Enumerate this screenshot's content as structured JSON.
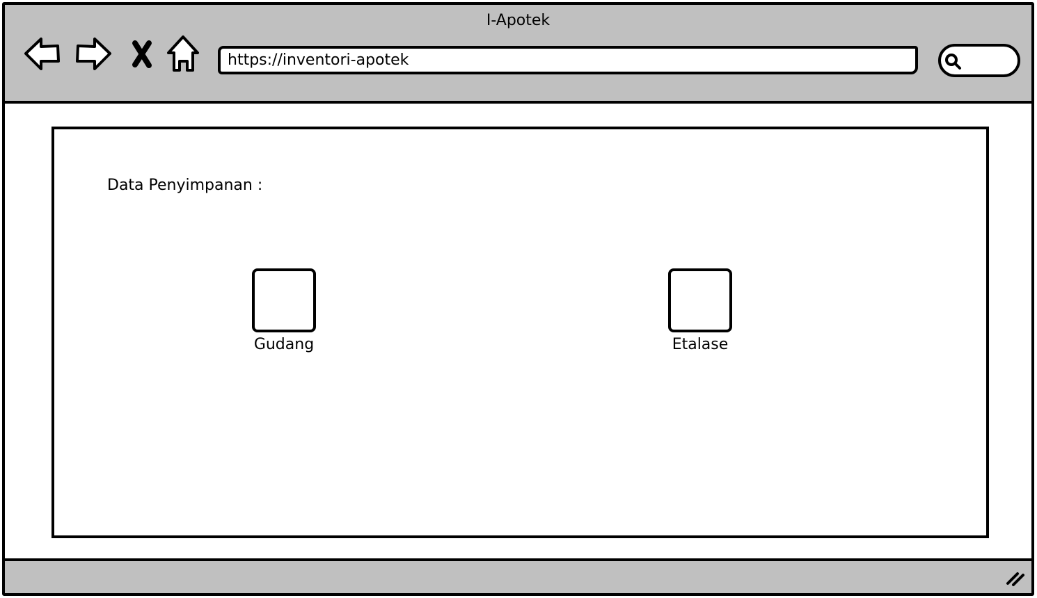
{
  "window": {
    "title": "I-Apotek"
  },
  "toolbar": {
    "back_icon": "back-arrow-icon",
    "forward_icon": "forward-arrow-icon",
    "stop_icon": "close-icon",
    "home_icon": "home-icon",
    "url": "https://inventori-apotek",
    "search_icon": "search-icon",
    "search_value": ""
  },
  "main": {
    "section_label": "Data Penyimpanan :",
    "options": [
      {
        "label": "Gudang"
      },
      {
        "label": "Etalase"
      }
    ]
  },
  "colors": {
    "chrome_gray": "#c0c0c0",
    "stroke": "#000000",
    "background": "#ffffff"
  }
}
